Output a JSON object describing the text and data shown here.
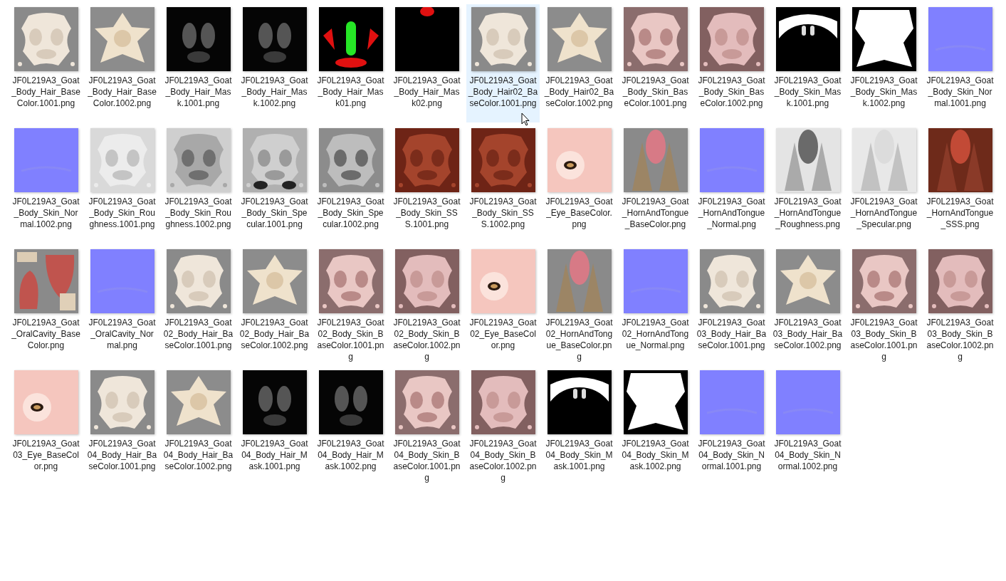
{
  "files": [
    {
      "name": "JF0L219A3_Goat_Body_Hair_BaseColor.1001.png",
      "selected": false
    },
    {
      "name": "JF0L219A3_Goat_Body_Hair_BaseColor.1002.png",
      "selected": false
    },
    {
      "name": "JF0L219A3_Goat_Body_Hair_Mask.1001.png",
      "selected": false
    },
    {
      "name": "JF0L219A3_Goat_Body_Hair_Mask.1002.png",
      "selected": false
    },
    {
      "name": "JF0L219A3_Goat_Body_Hair_Mask01.png",
      "selected": false
    },
    {
      "name": "JF0L219A3_Goat_Body_Hair_Mask02.png",
      "selected": false
    },
    {
      "name": "JF0L219A3_Goat_Body_Hair02_BaseColor.1001.png",
      "selected": true
    },
    {
      "name": "JF0L219A3_Goat_Body_Hair02_BaseColor.1002.png",
      "selected": false
    },
    {
      "name": "JF0L219A3_Goat_Body_Skin_BaseColor.1001.png",
      "selected": false
    },
    {
      "name": "JF0L219A3_Goat_Body_Skin_BaseColor.1002.png",
      "selected": false
    },
    {
      "name": "JF0L219A3_Goat_Body_Skin_Mask.1001.png",
      "selected": false
    },
    {
      "name": "JF0L219A3_Goat_Body_Skin_Mask.1002.png",
      "selected": false
    },
    {
      "name": "JF0L219A3_Goat_Body_Skin_Normal.1001.png",
      "selected": false
    },
    {
      "name": "JF0L219A3_Goat_Body_Skin_Normal.1002.png",
      "selected": false
    },
    {
      "name": "JF0L219A3_Goat_Body_Skin_Roughness.1001.png",
      "selected": false
    },
    {
      "name": "JF0L219A3_Goat_Body_Skin_Roughness.1002.png",
      "selected": false
    },
    {
      "name": "JF0L219A3_Goat_Body_Skin_Specular.1001.png",
      "selected": false
    },
    {
      "name": "JF0L219A3_Goat_Body_Skin_Specular.1002.png",
      "selected": false
    },
    {
      "name": "JF0L219A3_Goat_Body_Skin_SSS.1001.png",
      "selected": false
    },
    {
      "name": "JF0L219A3_Goat_Body_Skin_SSS.1002.png",
      "selected": false
    },
    {
      "name": "JF0L219A3_Goat_Eye_BaseColor.png",
      "selected": false
    },
    {
      "name": "JF0L219A3_Goat_HornAndTongue_BaseColor.png",
      "selected": false
    },
    {
      "name": "JF0L219A3_Goat_HornAndTongue_Normal.png",
      "selected": false
    },
    {
      "name": "JF0L219A3_Goat_HornAndTongue_Roughness.png",
      "selected": false
    },
    {
      "name": "JF0L219A3_Goat_HornAndTongue_Specular.png",
      "selected": false
    },
    {
      "name": "JF0L219A3_Goat_HornAndTongue_SSS.png",
      "selected": false
    },
    {
      "name": "JF0L219A3_Goat_OralCavity_BaseColor.png",
      "selected": false
    },
    {
      "name": "JF0L219A3_Goat_OralCavity_Normal.png",
      "selected": false
    },
    {
      "name": "JF0L219A3_Goat02_Body_Hair_BaseColor.1001.png",
      "selected": false
    },
    {
      "name": "JF0L219A3_Goat02_Body_Hair_BaseColor.1002.png",
      "selected": false
    },
    {
      "name": "JF0L219A3_Goat02_Body_Skin_BaseColor.1001.png",
      "selected": false
    },
    {
      "name": "JF0L219A3_Goat02_Body_Skin_BaseColor.1002.png",
      "selected": false
    },
    {
      "name": "JF0L219A3_Goat02_Eye_BaseColor.png",
      "selected": false
    },
    {
      "name": "JF0L219A3_Goat02_HornAndTongue_BaseColor.png",
      "selected": false
    },
    {
      "name": "JF0L219A3_Goat02_HornAndTongue_Normal.png",
      "selected": false
    },
    {
      "name": "JF0L219A3_Goat03_Body_Hair_BaseColor.1001.png",
      "selected": false
    },
    {
      "name": "JF0L219A3_Goat03_Body_Hair_BaseColor.1002.png",
      "selected": false
    },
    {
      "name": "JF0L219A3_Goat03_Body_Skin_BaseColor.1001.png",
      "selected": false
    },
    {
      "name": "JF0L219A3_Goat03_Body_Skin_BaseColor.1002.png",
      "selected": false
    },
    {
      "name": "JF0L219A3_Goat03_Eye_BaseColor.png",
      "selected": false
    },
    {
      "name": "JF0L219A3_Goat04_Body_Hair_BaseColor.1001.png",
      "selected": false
    },
    {
      "name": "JF0L219A3_Goat04_Body_Hair_BaseColor.1002.png",
      "selected": false
    },
    {
      "name": "JF0L219A3_Goat04_Body_Hair_Mask.1001.png",
      "selected": false
    },
    {
      "name": "JF0L219A3_Goat04_Body_Hair_Mask.1002.png",
      "selected": false
    },
    {
      "name": "JF0L219A3_Goat04_Body_Skin_BaseColor.1001.png",
      "selected": false
    },
    {
      "name": "JF0L219A3_Goat04_Body_Skin_BaseColor.1002.png",
      "selected": false
    },
    {
      "name": "JF0L219A3_Goat04_Body_Skin_Mask.1001.png",
      "selected": false
    },
    {
      "name": "JF0L219A3_Goat04_Body_Skin_Mask.1002.png",
      "selected": false
    },
    {
      "name": "JF0L219A3_Goat04_Body_Skin_Normal.1001.png",
      "selected": false
    },
    {
      "name": "JF0L219A3_Goat04_Body_Skin_Normal.1002.png",
      "selected": false
    }
  ]
}
